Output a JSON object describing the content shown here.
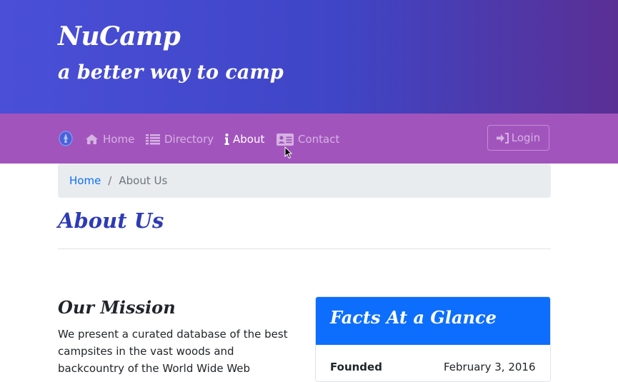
{
  "header": {
    "brand": "NuCamp",
    "tagline": "a better way to camp"
  },
  "nav": {
    "items": [
      {
        "label": "Home",
        "icon": "home-icon"
      },
      {
        "label": "Directory",
        "icon": "list-icon"
      },
      {
        "label": "About",
        "icon": "info-icon",
        "active": true
      },
      {
        "label": "Contact",
        "icon": "address-card-icon"
      }
    ],
    "login_label": "Login"
  },
  "breadcrumb": {
    "home": "Home",
    "current": "About Us"
  },
  "page": {
    "title": "About Us"
  },
  "mission": {
    "title": "Our Mission",
    "text": "We present a curated database of the best campsites in the vast woods and backcountry of the World Wide Web"
  },
  "facts": {
    "title": "Facts At a Glance",
    "rows": [
      {
        "label": "Founded",
        "value": "February 3, 2016"
      }
    ]
  },
  "colors": {
    "navbar": "#a254bd",
    "accent": "#0d6efd",
    "title": "#2d3bb5"
  }
}
